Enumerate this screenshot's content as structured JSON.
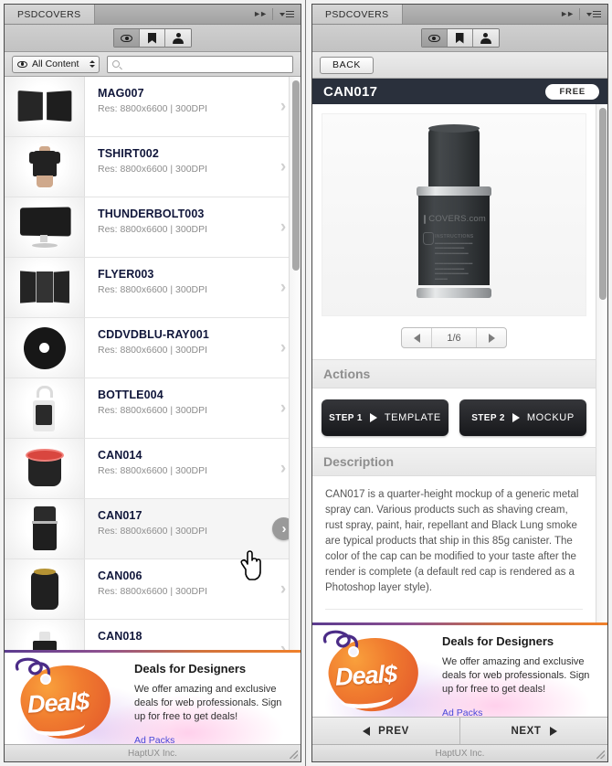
{
  "panels": {
    "left": {
      "tab_label": "PSDCOVERS",
      "toolbar": {
        "icons": [
          "eye-icon",
          "bookmark-icon",
          "person-icon"
        ],
        "active_index": 0
      },
      "filter": {
        "selected": "All Content",
        "search_value": "",
        "search_placeholder": ""
      },
      "items": [
        {
          "title": "MAG007",
          "meta": "Res: 8800x6600 | 300DPI",
          "thumb": "magazine-thumb",
          "selected": false
        },
        {
          "title": "TSHIRT002",
          "meta": "Res: 8800x6600 | 300DPI",
          "thumb": "tshirt-thumb",
          "selected": false
        },
        {
          "title": "THUNDERBOLT003",
          "meta": "Res: 8800x6600 | 300DPI",
          "thumb": "monitor-thumb",
          "selected": false
        },
        {
          "title": "FLYER003",
          "meta": "Res: 8800x6600 | 300DPI",
          "thumb": "flyer-thumb",
          "selected": false
        },
        {
          "title": "CDDVDBLU-RAY001",
          "meta": "Res: 8800x6600 | 300DPI",
          "thumb": "disc-thumb",
          "selected": false
        },
        {
          "title": "BOTTLE004",
          "meta": "Res: 8800x6600 | 300DPI",
          "thumb": "spraybottle-thumb",
          "selected": false
        },
        {
          "title": "CAN014",
          "meta": "Res: 8800x6600 | 300DPI",
          "thumb": "redcan-thumb",
          "selected": false
        },
        {
          "title": "CAN017",
          "meta": "Res: 8800x6600 | 300DPI",
          "thumb": "can17-thumb",
          "selected": true
        },
        {
          "title": "CAN006",
          "meta": "Res: 8800x6600 | 300DPI",
          "thumb": "goldcan-thumb",
          "selected": false
        },
        {
          "title": "CAN018",
          "meta": "",
          "thumb": "can18-thumb",
          "selected": false
        }
      ],
      "status_text": "HaptUX Inc."
    },
    "right": {
      "tab_label": "PSDCOVERS",
      "back_label": "BACK",
      "detail": {
        "title": "CAN017",
        "badge": "FREE",
        "image_brand": "COVERS.com",
        "image_instructions_heading": "INSTRUCTIONS",
        "pager": {
          "current": "1/6"
        },
        "actions_heading": "Actions",
        "buttons": [
          {
            "step": "STEP 1",
            "name": "TEMPLATE"
          },
          {
            "step": "STEP 2",
            "name": "MOCKUP"
          }
        ],
        "description_heading": "Description",
        "description": "CAN017 is a quarter-height mockup of a generic metal spray can. Various products such as shaving cream, rust spray, paint, hair, repellant and Black Lung smoke are typical products that ship in this 85g canister. The color of the cap can be modified to your taste after the render is complete (a default red cap is rendered as a Photoshop layer style)."
      },
      "nav": {
        "prev": "PREV",
        "next": "NEXT"
      },
      "status_text": "HaptUX Inc."
    }
  },
  "ad": {
    "logo_word": "Deal$",
    "title": "Deals for Designers",
    "body": "We offer amazing and exclusive deals for web professionals. Sign up for free to get deals!",
    "link": "Ad Packs"
  },
  "colors": {
    "title_bar": "#2a303c",
    "row_title": "#10163a",
    "link": "#4848d8",
    "accent_orange": "#f0802b",
    "accent_purple": "#5b3b8f"
  }
}
